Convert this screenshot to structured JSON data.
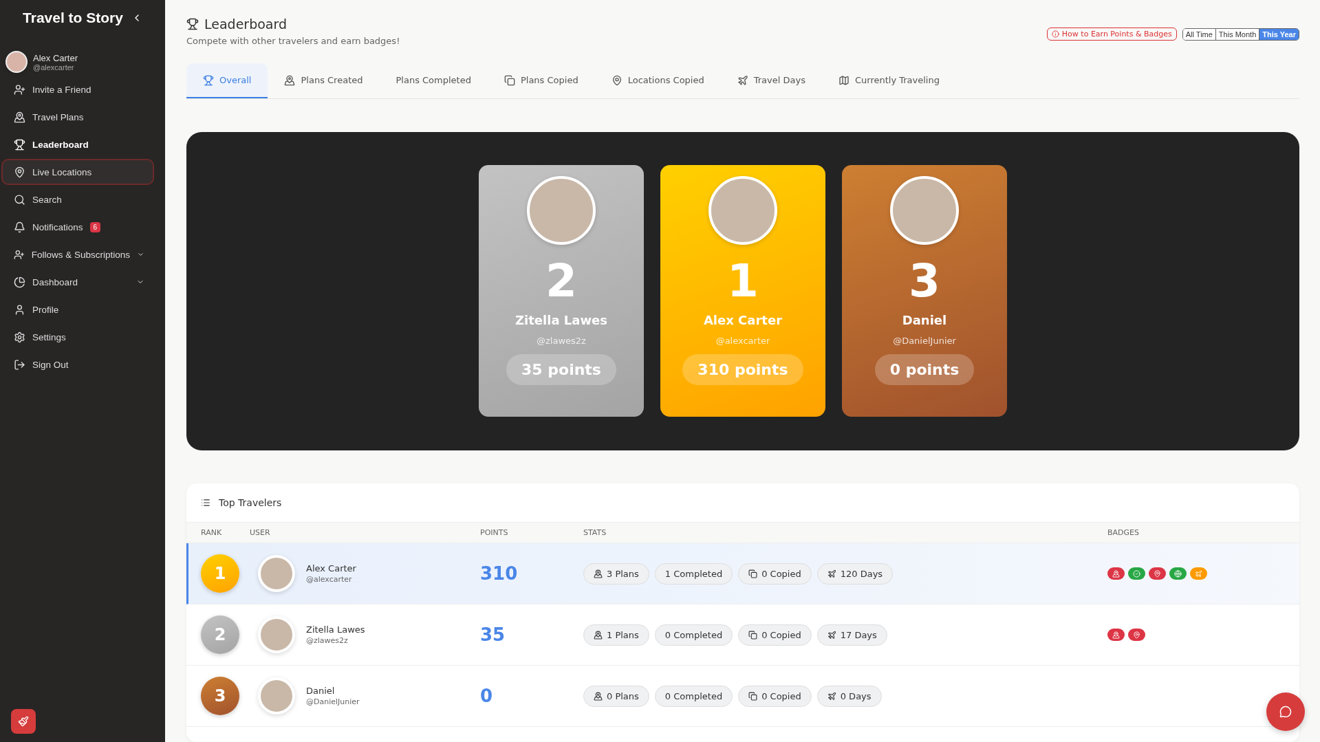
{
  "sidebar": {
    "brand": "Travel to Story",
    "user": {
      "name": "Alex Carter",
      "handle": "@alexcarter"
    },
    "items": [
      {
        "label": "Invite a Friend",
        "selected": false,
        "focused": false,
        "expandable": false
      },
      {
        "label": "Travel Plans",
        "selected": false,
        "focused": false,
        "expandable": false
      },
      {
        "label": "Leaderboard",
        "selected": true,
        "focused": false,
        "expandable": false
      },
      {
        "label": "Live Locations",
        "selected": false,
        "focused": true,
        "expandable": false
      },
      {
        "label": "Search",
        "selected": false,
        "focused": false,
        "expandable": false
      },
      {
        "label": "Notifications",
        "selected": false,
        "focused": false,
        "expandable": false,
        "badge": "6"
      },
      {
        "label": "Follows & Subscriptions",
        "selected": false,
        "focused": false,
        "expandable": true
      },
      {
        "label": "Dashboard",
        "selected": false,
        "focused": false,
        "expandable": true
      },
      {
        "label": "Profile",
        "selected": false,
        "focused": false,
        "expandable": false
      },
      {
        "label": "Settings",
        "selected": false,
        "focused": false,
        "expandable": false
      },
      {
        "label": "Sign Out",
        "selected": false,
        "focused": false,
        "expandable": false
      }
    ]
  },
  "header": {
    "title": "Leaderboard",
    "subtitle": "Compete with other travelers and earn badges!",
    "help_link": "How to Earn Points & Badges",
    "periods": [
      {
        "label": "All Time",
        "selected": false
      },
      {
        "label": "This Month",
        "selected": false
      },
      {
        "label": "This Year",
        "selected": true
      }
    ]
  },
  "tabs": [
    {
      "label": "Overall",
      "selected": true
    },
    {
      "label": "Plans Created",
      "selected": false
    },
    {
      "label": "Plans Completed",
      "selected": false
    },
    {
      "label": "Plans Copied",
      "selected": false
    },
    {
      "label": "Locations Copied",
      "selected": false
    },
    {
      "label": "Travel Days",
      "selected": false
    },
    {
      "label": "Currently Traveling",
      "selected": false
    }
  ],
  "podium": [
    {
      "rank": "2",
      "name": "Zitella Lawes",
      "handle": "@zlawes2z",
      "points": "35 points"
    },
    {
      "rank": "1",
      "name": "Alex Carter",
      "handle": "@alexcarter",
      "points": "310 points"
    },
    {
      "rank": "3",
      "name": "Daniel",
      "handle": "@DanielJunier",
      "points": "0 points"
    }
  ],
  "top_travelers": {
    "title": "Top Travelers",
    "columns": [
      "RANK",
      "USER",
      "POINTS",
      "STATS",
      "BADGES"
    ],
    "rows": [
      {
        "rank": "1",
        "name": "Alex Carter",
        "handle": "@alexcarter",
        "points": "310",
        "selected": true,
        "stats": [
          "3 Plans",
          "1 Completed",
          "0 Copied",
          "120 Days"
        ],
        "badges": [
          {
            "kind": "map",
            "color": "#dc3545"
          },
          {
            "kind": "check",
            "color": "#28a745"
          },
          {
            "kind": "pin",
            "color": "#dc3545"
          },
          {
            "kind": "globe",
            "color": "#28a745"
          },
          {
            "kind": "plane",
            "color": "#fd9a00"
          }
        ]
      },
      {
        "rank": "2",
        "name": "Zitella Lawes",
        "handle": "@zlawes2z",
        "points": "35",
        "selected": false,
        "stats": [
          "1 Plans",
          "0 Completed",
          "0 Copied",
          "17 Days"
        ],
        "badges": [
          {
            "kind": "map",
            "color": "#dc3545"
          },
          {
            "kind": "pin",
            "color": "#dc3545"
          }
        ]
      },
      {
        "rank": "3",
        "name": "Daniel",
        "handle": "@DanielJunier",
        "points": "0",
        "selected": false,
        "stats": [
          "0 Plans",
          "0 Completed",
          "0 Copied",
          "0 Days"
        ]
      }
    ]
  }
}
